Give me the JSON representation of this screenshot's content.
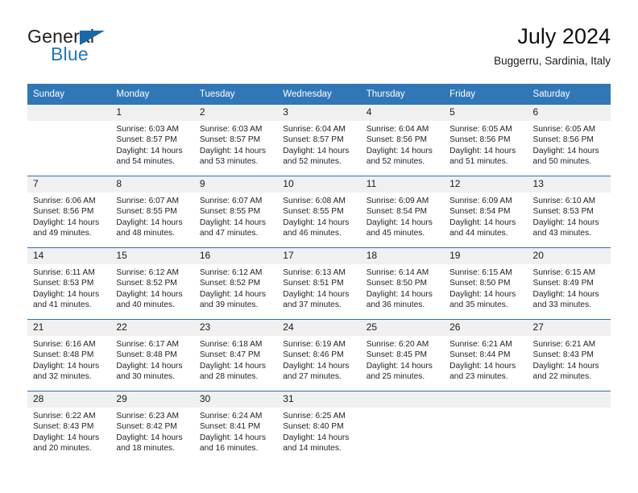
{
  "brand": {
    "name_part1": "General",
    "name_part2": "Blue",
    "triangle_icon": "brand-triangle-icon",
    "colors": {
      "dark": "#231f20",
      "blue": "#2077c4",
      "triangle": "#1769aa"
    }
  },
  "header": {
    "title": "July 2024",
    "subtitle": "Buggerru, Sardinia, Italy"
  },
  "theme": {
    "header_bg": "#3077b8",
    "row_divider": "#2f74b5",
    "daynum_bg": "#f0f0f0"
  },
  "calendar": {
    "weekday_headers": [
      "Sunday",
      "Monday",
      "Tuesday",
      "Wednesday",
      "Thursday",
      "Friday",
      "Saturday"
    ],
    "weeks": [
      [
        {
          "day": "",
          "blank": true,
          "lines": []
        },
        {
          "day": "1",
          "lines": [
            "Sunrise: 6:03 AM",
            "Sunset: 8:57 PM",
            "Daylight: 14 hours",
            "and 54 minutes."
          ]
        },
        {
          "day": "2",
          "lines": [
            "Sunrise: 6:03 AM",
            "Sunset: 8:57 PM",
            "Daylight: 14 hours",
            "and 53 minutes."
          ]
        },
        {
          "day": "3",
          "lines": [
            "Sunrise: 6:04 AM",
            "Sunset: 8:57 PM",
            "Daylight: 14 hours",
            "and 52 minutes."
          ]
        },
        {
          "day": "4",
          "lines": [
            "Sunrise: 6:04 AM",
            "Sunset: 8:56 PM",
            "Daylight: 14 hours",
            "and 52 minutes."
          ]
        },
        {
          "day": "5",
          "lines": [
            "Sunrise: 6:05 AM",
            "Sunset: 8:56 PM",
            "Daylight: 14 hours",
            "and 51 minutes."
          ]
        },
        {
          "day": "6",
          "lines": [
            "Sunrise: 6:05 AM",
            "Sunset: 8:56 PM",
            "Daylight: 14 hours",
            "and 50 minutes."
          ]
        }
      ],
      [
        {
          "day": "7",
          "lines": [
            "Sunrise: 6:06 AM",
            "Sunset: 8:56 PM",
            "Daylight: 14 hours",
            "and 49 minutes."
          ]
        },
        {
          "day": "8",
          "lines": [
            "Sunrise: 6:07 AM",
            "Sunset: 8:55 PM",
            "Daylight: 14 hours",
            "and 48 minutes."
          ]
        },
        {
          "day": "9",
          "lines": [
            "Sunrise: 6:07 AM",
            "Sunset: 8:55 PM",
            "Daylight: 14 hours",
            "and 47 minutes."
          ]
        },
        {
          "day": "10",
          "lines": [
            "Sunrise: 6:08 AM",
            "Sunset: 8:55 PM",
            "Daylight: 14 hours",
            "and 46 minutes."
          ]
        },
        {
          "day": "11",
          "lines": [
            "Sunrise: 6:09 AM",
            "Sunset: 8:54 PM",
            "Daylight: 14 hours",
            "and 45 minutes."
          ]
        },
        {
          "day": "12",
          "lines": [
            "Sunrise: 6:09 AM",
            "Sunset: 8:54 PM",
            "Daylight: 14 hours",
            "and 44 minutes."
          ]
        },
        {
          "day": "13",
          "lines": [
            "Sunrise: 6:10 AM",
            "Sunset: 8:53 PM",
            "Daylight: 14 hours",
            "and 43 minutes."
          ]
        }
      ],
      [
        {
          "day": "14",
          "lines": [
            "Sunrise: 6:11 AM",
            "Sunset: 8:53 PM",
            "Daylight: 14 hours",
            "and 41 minutes."
          ]
        },
        {
          "day": "15",
          "lines": [
            "Sunrise: 6:12 AM",
            "Sunset: 8:52 PM",
            "Daylight: 14 hours",
            "and 40 minutes."
          ]
        },
        {
          "day": "16",
          "lines": [
            "Sunrise: 6:12 AM",
            "Sunset: 8:52 PM",
            "Daylight: 14 hours",
            "and 39 minutes."
          ]
        },
        {
          "day": "17",
          "lines": [
            "Sunrise: 6:13 AM",
            "Sunset: 8:51 PM",
            "Daylight: 14 hours",
            "and 37 minutes."
          ]
        },
        {
          "day": "18",
          "lines": [
            "Sunrise: 6:14 AM",
            "Sunset: 8:50 PM",
            "Daylight: 14 hours",
            "and 36 minutes."
          ]
        },
        {
          "day": "19",
          "lines": [
            "Sunrise: 6:15 AM",
            "Sunset: 8:50 PM",
            "Daylight: 14 hours",
            "and 35 minutes."
          ]
        },
        {
          "day": "20",
          "lines": [
            "Sunrise: 6:15 AM",
            "Sunset: 8:49 PM",
            "Daylight: 14 hours",
            "and 33 minutes."
          ]
        }
      ],
      [
        {
          "day": "21",
          "lines": [
            "Sunrise: 6:16 AM",
            "Sunset: 8:48 PM",
            "Daylight: 14 hours",
            "and 32 minutes."
          ]
        },
        {
          "day": "22",
          "lines": [
            "Sunrise: 6:17 AM",
            "Sunset: 8:48 PM",
            "Daylight: 14 hours",
            "and 30 minutes."
          ]
        },
        {
          "day": "23",
          "lines": [
            "Sunrise: 6:18 AM",
            "Sunset: 8:47 PM",
            "Daylight: 14 hours",
            "and 28 minutes."
          ]
        },
        {
          "day": "24",
          "lines": [
            "Sunrise: 6:19 AM",
            "Sunset: 8:46 PM",
            "Daylight: 14 hours",
            "and 27 minutes."
          ]
        },
        {
          "day": "25",
          "lines": [
            "Sunrise: 6:20 AM",
            "Sunset: 8:45 PM",
            "Daylight: 14 hours",
            "and 25 minutes."
          ]
        },
        {
          "day": "26",
          "lines": [
            "Sunrise: 6:21 AM",
            "Sunset: 8:44 PM",
            "Daylight: 14 hours",
            "and 23 minutes."
          ]
        },
        {
          "day": "27",
          "lines": [
            "Sunrise: 6:21 AM",
            "Sunset: 8:43 PM",
            "Daylight: 14 hours",
            "and 22 minutes."
          ]
        }
      ],
      [
        {
          "day": "28",
          "lines": [
            "Sunrise: 6:22 AM",
            "Sunset: 8:43 PM",
            "Daylight: 14 hours",
            "and 20 minutes."
          ]
        },
        {
          "day": "29",
          "lines": [
            "Sunrise: 6:23 AM",
            "Sunset: 8:42 PM",
            "Daylight: 14 hours",
            "and 18 minutes."
          ]
        },
        {
          "day": "30",
          "lines": [
            "Sunrise: 6:24 AM",
            "Sunset: 8:41 PM",
            "Daylight: 14 hours",
            "and 16 minutes."
          ]
        },
        {
          "day": "31",
          "lines": [
            "Sunrise: 6:25 AM",
            "Sunset: 8:40 PM",
            "Daylight: 14 hours",
            "and 14 minutes."
          ]
        },
        {
          "day": "",
          "blank": true,
          "lines": []
        },
        {
          "day": "",
          "blank": true,
          "lines": []
        },
        {
          "day": "",
          "blank": true,
          "lines": []
        }
      ]
    ]
  }
}
